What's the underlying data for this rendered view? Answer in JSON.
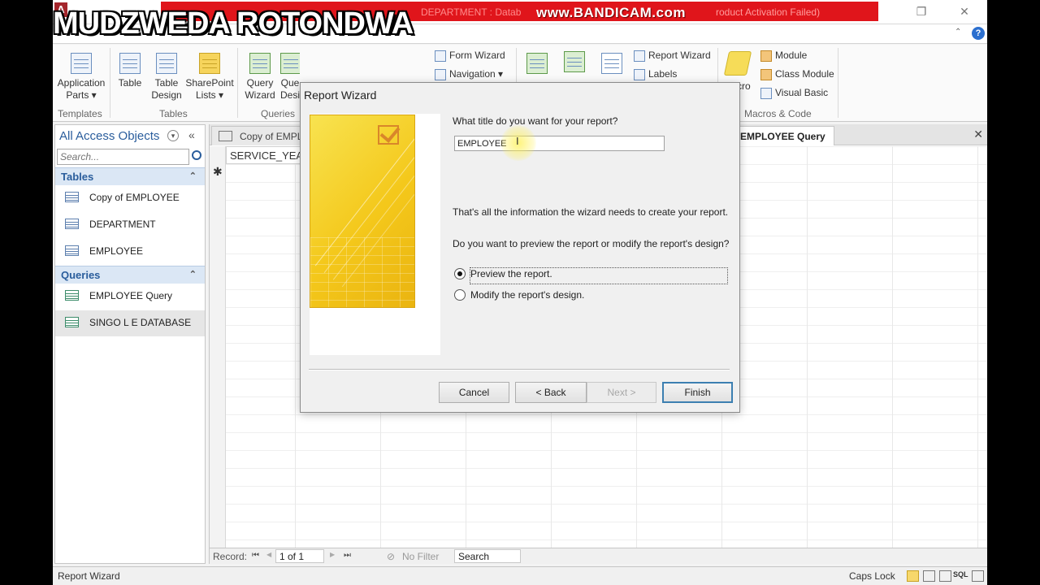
{
  "window": {
    "doc_title": "DEPARTMENT : Datab",
    "bandicam": "www.BANDICAM.com",
    "activation": "roduct Activation Failed)",
    "watermark": "MUDZWEDA ROTONDWA",
    "logo": "A"
  },
  "ribbon": {
    "groups": {
      "templates": "Templates",
      "tables": "Tables",
      "queries": "Queries",
      "macros_code": "Macros & Code"
    },
    "buttons": {
      "application_parts_1": "Application",
      "application_parts_2": "Parts ▾",
      "table": "Table",
      "table_design_1": "Table",
      "table_design_2": "Design",
      "sharepoint_1": "SharePoint",
      "sharepoint_2": "Lists ▾",
      "query_wizard_1": "Query",
      "query_wizard_2": "Wizard",
      "query_design_1": "Que",
      "query_design_2": "Desi",
      "form_wizard": "Form Wizard",
      "navigation": "Navigation ▾",
      "report_wizard": "Report Wizard",
      "labels": "Labels",
      "macro_partial": "cro",
      "module": "Module",
      "class_module": "Class Module",
      "visual_basic": "Visual Basic"
    }
  },
  "nav": {
    "title": "All Access Objects",
    "search_placeholder": "Search...",
    "sections": [
      {
        "label": "Tables",
        "items": [
          "Copy of EMPLOYEE",
          "DEPARTMENT",
          "EMPLOYEE"
        ]
      },
      {
        "label": "Queries",
        "items": [
          "EMPLOYEE Query",
          "SINGO L E DATABASE"
        ]
      }
    ]
  },
  "doc": {
    "tab_copy": "Copy of EMPLO",
    "tab_query": "EMPLOYEE Query",
    "column": "SERVICE_YEA",
    "new_row": "✱"
  },
  "recordbar": {
    "label": "Record:",
    "first": "⏮",
    "prev": "◀",
    "current": "1 of 1",
    "next": "▶",
    "last": "⏭",
    "filter": "No Filter",
    "search": "Search"
  },
  "status": {
    "left": "Report Wizard",
    "caps": "Caps Lock",
    "sql": "SQL"
  },
  "dialog": {
    "title": "Report Wizard",
    "question_title": "What title do you want for your report?",
    "title_value": "EMPLOYEE",
    "info": "That's all the information the wizard needs to create your report.",
    "question_preview": "Do you want to preview the report or modify the report's design?",
    "option_preview": "Preview the report.",
    "option_modify": "Modify the report's design.",
    "selected_option": "preview",
    "buttons": {
      "cancel": "Cancel",
      "back": "< Back",
      "next": "Next >",
      "finish": "Finish"
    }
  },
  "colors": {
    "title_red": "#e0151b",
    "access_red": "#a4262c",
    "nav_blue": "#2a5d9c",
    "wizard_yellow": "#f4c81b"
  }
}
